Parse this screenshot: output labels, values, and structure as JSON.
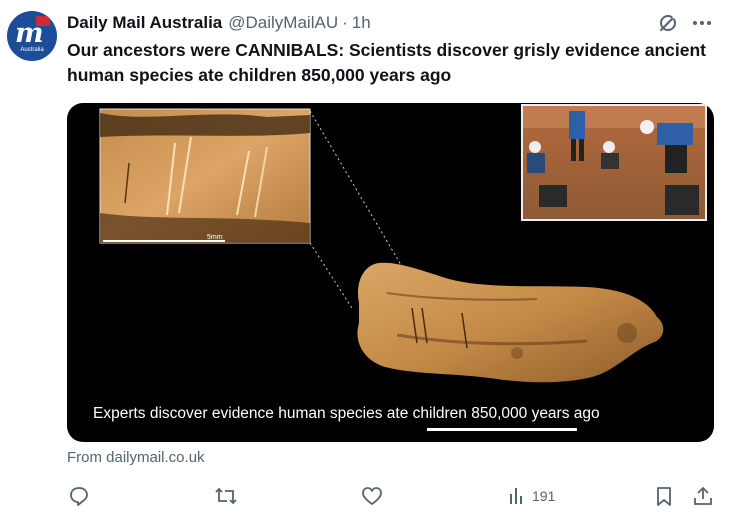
{
  "author": {
    "display_name": "Daily Mail Australia",
    "handle": "@DailyMailAU",
    "separator": "·",
    "time": "1h",
    "avatar": {
      "mark": "m",
      "sub_label": "Australia",
      "brand_color": "#1b4d99"
    }
  },
  "tweet": {
    "text": "Our ancestors were CANNIBALS: Scientists discover grisly evidence ancient human species ate children 850,000 years ago"
  },
  "card": {
    "caption": "Experts discover evidence human species ate children 850,000 years ago",
    "inset_scale_label": "5mm",
    "source": "From dailymail.co.uk"
  },
  "actions": {
    "reply_icon": "reply-icon",
    "repost_icon": "repost-icon",
    "like_icon": "like-icon",
    "views_icon": "views-icon",
    "views_count": "191",
    "bookmark_icon": "bookmark-icon",
    "share_icon": "share-icon"
  },
  "colors": {
    "text_primary": "#0f1419",
    "text_secondary": "#536471",
    "card_background": "#000000"
  }
}
